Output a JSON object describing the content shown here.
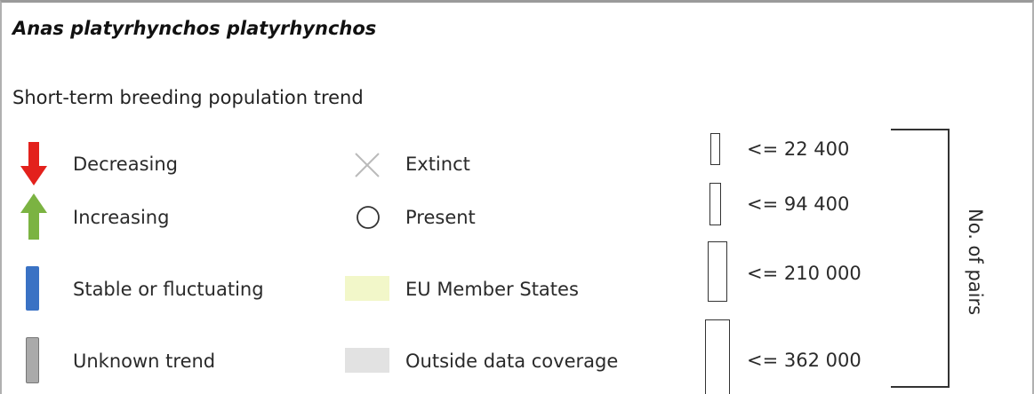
{
  "header": {
    "species_name": "Anas platyrhynchos platyrhynchos",
    "subtitle": "Short-term breeding population trend"
  },
  "trend_legend": [
    {
      "icon": "arrow-down-icon",
      "label": "Decreasing",
      "color": "#e3211c"
    },
    {
      "icon": "arrow-up-icon",
      "label": "Increasing",
      "color": "#7bb342"
    },
    {
      "icon": "bar-icon",
      "label": "Stable or fluctuating",
      "color": "#3a72c4"
    },
    {
      "icon": "bar-icon",
      "label": "Unknown trend",
      "color": "#aaaaaa"
    }
  ],
  "status_legend": [
    {
      "icon": "cross-icon",
      "label": "Extinct",
      "color": "#bbbbbb"
    },
    {
      "icon": "circle-icon",
      "label": "Present",
      "color": "#333333"
    },
    {
      "icon": "swatch",
      "label": "EU Member States",
      "color": "#f2f7c9"
    },
    {
      "icon": "swatch",
      "label": "Outside data coverage",
      "color": "#e2e2e2"
    }
  ],
  "size_legend": {
    "classes": [
      {
        "label": "<= 22 400"
      },
      {
        "label": "<= 94 400"
      },
      {
        "label": "<= 210 000"
      },
      {
        "label": "<= 362 000"
      }
    ],
    "axis_label": "No. of pairs"
  }
}
